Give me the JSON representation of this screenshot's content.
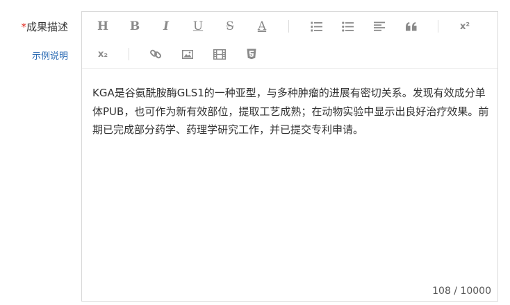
{
  "form": {
    "required_mark": "*",
    "field_label": "成果描述",
    "example_link": "示例说明"
  },
  "editor": {
    "toolbar": {
      "row1": [
        {
          "name": "heading",
          "icon": "heading-icon",
          "glyph": "H"
        },
        {
          "name": "bold",
          "icon": "bold-icon",
          "glyph": "B"
        },
        {
          "name": "italic",
          "icon": "italic-icon",
          "glyph": "I"
        },
        {
          "name": "underline",
          "icon": "underline-icon",
          "glyph": "U"
        },
        {
          "name": "strikethrough",
          "icon": "strikethrough-icon",
          "glyph": "S"
        },
        {
          "name": "font-color",
          "icon": "font-color-icon",
          "glyph": "A"
        },
        {
          "name": "ordered-list",
          "icon": "ordered-list-icon"
        },
        {
          "name": "unordered-list",
          "icon": "unordered-list-icon"
        },
        {
          "name": "align",
          "icon": "align-left-icon"
        },
        {
          "name": "blockquote",
          "icon": "quote-icon"
        },
        {
          "name": "superscript",
          "icon": "superscript-icon",
          "glyph": "x²"
        }
      ],
      "row2": [
        {
          "name": "subscript",
          "icon": "subscript-icon",
          "glyph": "x₂"
        },
        {
          "name": "link",
          "icon": "link-icon"
        },
        {
          "name": "image",
          "icon": "image-icon"
        },
        {
          "name": "video",
          "icon": "video-icon"
        },
        {
          "name": "html5",
          "icon": "html5-icon"
        }
      ]
    },
    "content": "KGA是谷氨酰胺酶GLS1的一种亚型，与多种肿瘤的进展有密切关系。发现有效成分单体PUB，也可作为新有效部位，提取工艺成熟；在动物实验中显示出良好治疗效果。前期已完成部分药学、药理学研究工作，并已提交专利申请。",
    "char_count": "108 / 10000"
  },
  "colors": {
    "required": "#e0251b",
    "link": "#2a6ab3",
    "icon": "#8a8a8a",
    "border": "#d9d9d9"
  }
}
